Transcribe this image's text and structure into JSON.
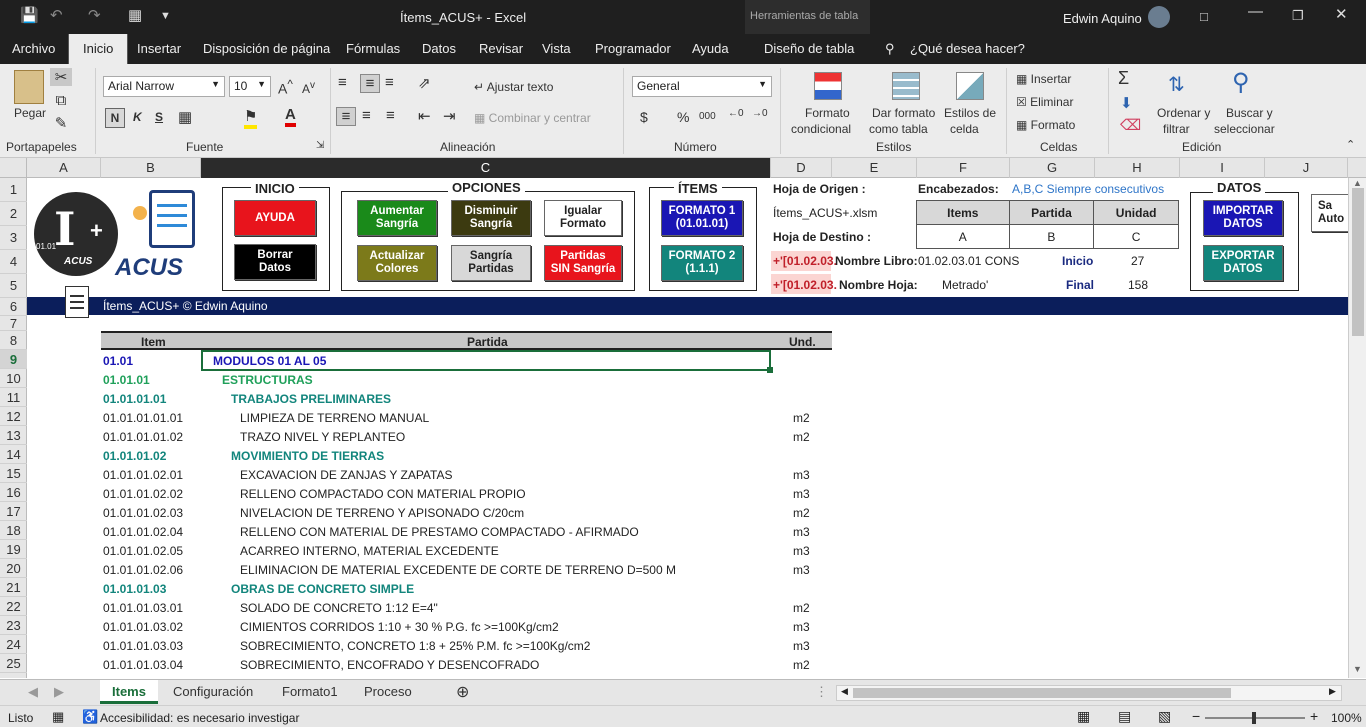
{
  "titlebar": {
    "file": "Ítems_ACUS+",
    "app": "Excel",
    "sep": "-",
    "context": "Herramientas de tabla",
    "user": "Edwin Aquino"
  },
  "tabs": [
    "Archivo",
    "Inicio",
    "Insertar",
    "Disposición de página",
    "Fórmulas",
    "Datos",
    "Revisar",
    "Vista",
    "Programador",
    "Ayuda",
    "Diseño de tabla"
  ],
  "tell_me": "¿Qué desea hacer?",
  "ribbon": {
    "clipboard": {
      "paste": "Pegar",
      "group": "Portapapeles"
    },
    "font": {
      "name": "Arial Narrow",
      "size": "10",
      "bold": "N",
      "italic": "K",
      "underline": "S",
      "group": "Fuente"
    },
    "align": {
      "wrap": "Ajustar texto",
      "merge": "Combinar y centrar",
      "group": "Alineación"
    },
    "number": {
      "format": "General",
      "currency": "$",
      "percent": "%",
      "thousands": "000",
      "group": "Número"
    },
    "styles": {
      "cond1": "Formato",
      "cond2": "condicional",
      "table1": "Dar formato",
      "table2": "como tabla",
      "cell1": "Estilos de",
      "cell2": "celda",
      "group": "Estilos"
    },
    "cells": {
      "insert": "Insertar",
      "delete": "Eliminar",
      "format": "Formato",
      "group": "Celdas"
    },
    "edit": {
      "sort1": "Ordenar y",
      "sort2": "filtrar",
      "find1": "Buscar y",
      "find2": "seleccionar",
      "group": "Edición"
    }
  },
  "columns": [
    "A",
    "B",
    "C",
    "D",
    "E",
    "F",
    "G",
    "H",
    "I",
    "J"
  ],
  "rows": [
    "1",
    "2",
    "3",
    "4",
    "5",
    "6",
    "7",
    "8",
    "9",
    "10",
    "11",
    "12",
    "13",
    "14",
    "15",
    "16",
    "17",
    "18",
    "19",
    "20",
    "21",
    "22",
    "23",
    "24",
    "25"
  ],
  "panel": {
    "inicio": "INICIO",
    "opciones": "OPCIONES",
    "items": "ÍTEMS",
    "datos": "DATOS",
    "ayuda": "AYUDA",
    "borrar1": "Borrar",
    "borrar2": "Datos",
    "aum1": "Aumentar",
    "aum2": "Sangría",
    "dis1": "Disminuir",
    "dis2": "Sangría",
    "ig1": "Igualar",
    "ig2": "Formato",
    "act1": "Actualizar",
    "act2": "Colores",
    "sp1": "Sangría",
    "sp2": "Partidas",
    "psin1": "Partidas",
    "psin2": "SIN Sangría",
    "f1a": "FORMATO 1",
    "f1b": "(01.01.01)",
    "f2a": "FORMATO 2",
    "f2b": "(1.1.1)",
    "imp1": "IMPORTAR",
    "imp2": "DATOS",
    "exp1": "EXPORTAR",
    "exp2": "DATOS",
    "origen_lbl": "Hoja de Origen :",
    "origen_val": "Ítems_ACUS+.xlsm",
    "destino_lbl": "Hoja de Destino :",
    "enc_lbl": "Encabezados:",
    "enc_note": "A,B,C  Siempre consecutivos",
    "th_items": "Items",
    "th_partida": "Partida",
    "th_unidad": "Unidad",
    "td_a": "A",
    "td_b": "B",
    "td_c": "C",
    "ref1": "+'[01.02.03.",
    "ref2": "+'[01.02.03.",
    "libro_lbl": "Nombre Libro:",
    "libro_val": "01.02.03.01 CONS",
    "hoja_lbl": "Nombre Hoja:",
    "hoja_val": "Metrado'",
    "inicio_lbl": "Inicio",
    "inicio_val": "27",
    "final_lbl": "Final",
    "final_val": "158",
    "extra1": "Sa",
    "extra2": "Auto",
    "logo_text": "ACUS",
    "logo_small": "01.01",
    "banner": "Ítems_ACUS+ © Edwin Aquino"
  },
  "table": {
    "headers": {
      "item": "Item",
      "partida": "Partida",
      "und": "Und."
    },
    "rows": [
      {
        "item": "01.01",
        "partida": "MODULOS 01 AL 05",
        "und": "",
        "lvl": 1
      },
      {
        "item": "01.01.01",
        "partida": "ESTRUCTURAS",
        "und": "",
        "lvl": 2
      },
      {
        "item": "01.01.01.01",
        "partida": "TRABAJOS PRELIMINARES",
        "und": "",
        "lvl": 3
      },
      {
        "item": "01.01.01.01.01",
        "partida": "LIMPIEZA DE TERRENO MANUAL",
        "und": "m2",
        "lvl": 4
      },
      {
        "item": "01.01.01.01.02",
        "partida": "TRAZO NIVEL Y REPLANTEO",
        "und": "m2",
        "lvl": 4
      },
      {
        "item": "01.01.01.02",
        "partida": "MOVIMIENTO DE TIERRAS",
        "und": "",
        "lvl": 3
      },
      {
        "item": "01.01.01.02.01",
        "partida": "EXCAVACION DE ZANJAS Y ZAPATAS",
        "und": "m3",
        "lvl": 4
      },
      {
        "item": "01.01.01.02.02",
        "partida": "RELLENO COMPACTADO CON MATERIAL PROPIO",
        "und": "m3",
        "lvl": 4
      },
      {
        "item": "01.01.01.02.03",
        "partida": "NIVELACION DE TERRENO Y APISONADO C/20cm",
        "und": "m2",
        "lvl": 4
      },
      {
        "item": "01.01.01.02.04",
        "partida": "RELLENO CON MATERIAL DE PRESTAMO COMPACTADO - AFIRMADO",
        "und": "m3",
        "lvl": 4
      },
      {
        "item": "01.01.01.02.05",
        "partida": "ACARREO INTERNO, MATERIAL EXCEDENTE",
        "und": "m3",
        "lvl": 4
      },
      {
        "item": "01.01.01.02.06",
        "partida": "ELIMINACION DE MATERIAL EXCEDENTE DE CORTE DE TERRENO D=500 M",
        "und": "m3",
        "lvl": 4
      },
      {
        "item": "01.01.01.03",
        "partida": "OBRAS DE CONCRETO SIMPLE",
        "und": "",
        "lvl": 3
      },
      {
        "item": "01.01.01.03.01",
        "partida": "SOLADO DE CONCRETO 1:12 E=4\"",
        "und": "m2",
        "lvl": 4
      },
      {
        "item": "01.01.01.03.02",
        "partida": "CIMIENTOS CORRIDOS 1:10 + 30 % P.G. fc >=100Kg/cm2",
        "und": "m3",
        "lvl": 4
      },
      {
        "item": "01.01.01.03.03",
        "partida": "SOBRECIMIENTO, CONCRETO 1:8 + 25% P.M.  fc >=100Kg/cm2",
        "und": "m3",
        "lvl": 4
      },
      {
        "item": "01.01.01.03.04",
        "partida": "SOBRECIMIENTO, ENCOFRADO Y DESENCOFRADO",
        "und": "m2",
        "lvl": 4
      }
    ]
  },
  "sheets": [
    "Items",
    "Configuración",
    "Formato1",
    "Proceso"
  ],
  "status": {
    "ready": "Listo",
    "access": "Accesibilidad: es necesario investigar",
    "zoom": "100%"
  },
  "colors": {
    "accent": "#217346",
    "navy": "#0b1e5b"
  }
}
